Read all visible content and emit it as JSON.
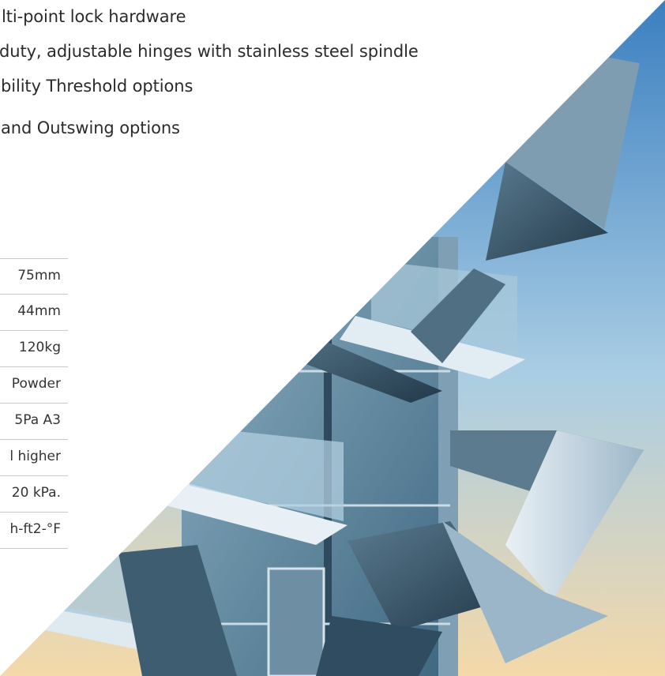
{
  "features": [
    "lti-point lock hardware",
    "duty, adjustable hinges with stainless steel spindle",
    "bility Threshold options",
    " and Outswing options"
  ],
  "specs": [
    "75mm",
    "44mm",
    "120kg",
    "Powder",
    "5Pa A3",
    "l higher",
    "20 kPa.",
    "h-ft2-°F"
  ],
  "photo": {
    "subject": "modern glass building with cantilevered balconies",
    "colors": {
      "sky_top": "#3b7fc0",
      "sky_mid": "#a9cde4",
      "sky_low": "#f4d9a9",
      "glass": "#5f8aa3",
      "panel_light": "#d8e6f0",
      "panel_dark": "#2f4c61"
    }
  }
}
